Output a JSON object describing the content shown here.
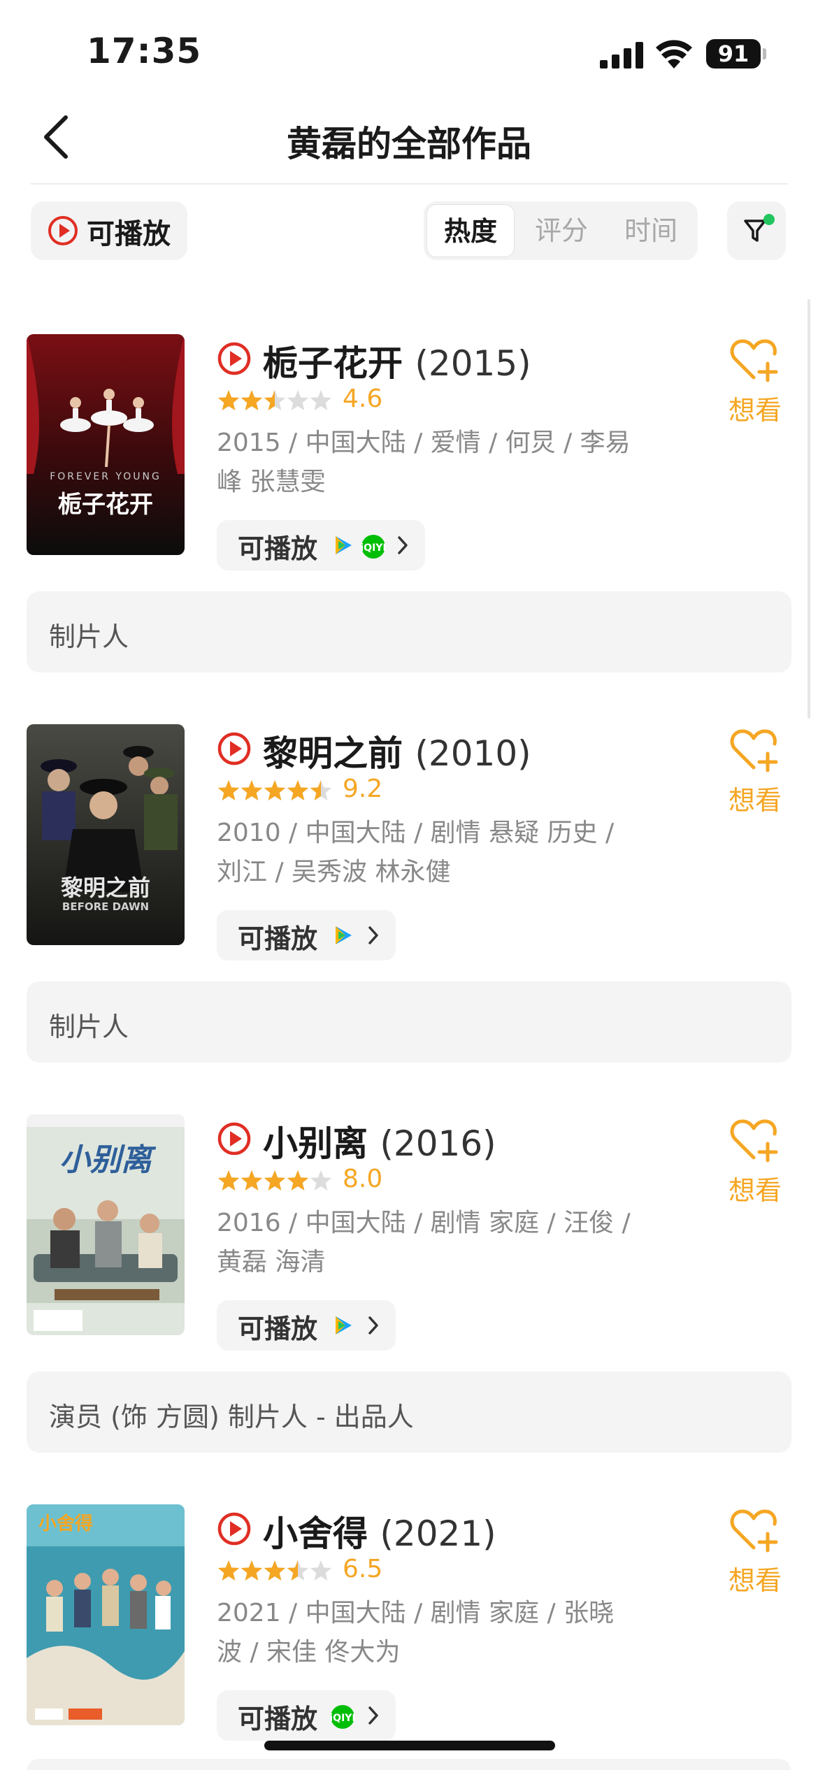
{
  "status_bar": {
    "time": "17:35",
    "battery": "91"
  },
  "nav": {
    "title": "黄磊的全部作品"
  },
  "filters": {
    "playable_label": "可播放",
    "sort_tabs": [
      "热度",
      "评分",
      "时间"
    ],
    "active_sort": "热度",
    "filter_active": true,
    "indicator_color": "#22c55e"
  },
  "colors": {
    "accent": "#f5a623",
    "play_red": "#e02e24",
    "text": "#1a1a1a",
    "muted": "#888888"
  },
  "films": [
    {
      "title": "栀子花开",
      "year": "(2015)",
      "rating": "4.6",
      "stars": 2.5,
      "meta_line1": "2015 / 中国大陆 / 爱情 / 何炅 / 李易",
      "meta_line2": "峰 张慧雯",
      "play_label": "可播放",
      "platforms": [
        "tencent-video-icon",
        "iqiyi-icon"
      ],
      "want_label": "想看",
      "role": "制片人",
      "poster_text": "栀子花开",
      "poster_subtext": "FOREVER YOUNG"
    },
    {
      "title": "黎明之前",
      "year": "(2010)",
      "rating": "9.2",
      "stars": 4.5,
      "meta_line1": "2010 / 中国大陆 / 剧情 悬疑 历史 /",
      "meta_line2": "刘江 / 吴秀波 林永健",
      "play_label": "可播放",
      "platforms": [
        "tencent-video-icon"
      ],
      "want_label": "想看",
      "role": "制片人",
      "poster_text": "黎明之前",
      "poster_subtext": "BEFORE DAWN"
    },
    {
      "title": "小别离",
      "year": "(2016)",
      "rating": "8.0",
      "stars": 4,
      "meta_line1": "2016 / 中国大陆 / 剧情 家庭 / 汪俊 /",
      "meta_line2": "黄磊 海清",
      "play_label": "可播放",
      "platforms": [
        "tencent-video-icon"
      ],
      "want_label": "想看",
      "role": "演员 (饰 方圆) 制片人 - 出品人",
      "poster_text": "小别离",
      "poster_subtext": ""
    },
    {
      "title": "小舍得",
      "year": "(2021)",
      "rating": "6.5",
      "stars": 3.5,
      "meta_line1": "2021 / 中国大陆 / 剧情 家庭 / 张晓",
      "meta_line2": "波 / 宋佳 佟大为",
      "play_label": "可播放",
      "platforms": [
        "iqiyi-icon"
      ],
      "want_label": "想看",
      "role": "",
      "poster_text": "小舍得",
      "poster_subtext": ""
    }
  ]
}
